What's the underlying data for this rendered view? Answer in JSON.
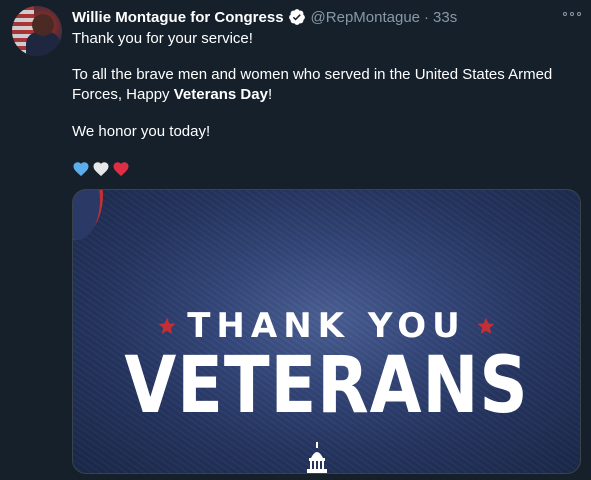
{
  "tweet": {
    "display_name": "Willie Montague for Congress",
    "handle": "@RepMontague",
    "separator": "·",
    "time": "33s",
    "text": {
      "line1": "Thank you for your service!",
      "line2": "To all the brave men and women who served in the United States Armed",
      "line3_prefix": "Forces, Happy ",
      "line3_bold": "Veterans Day",
      "line3_suffix": "!",
      "line4": "We honor you today!"
    },
    "hearts": [
      "blue-heart",
      "white-heart",
      "red-heart"
    ]
  },
  "media": {
    "thank_you": "THANK YOU",
    "veterans": "VETERANS"
  },
  "colors": {
    "background": "#15202b",
    "secondary_text": "#8899a6",
    "accent_blue": "#1da1f2",
    "star_red": "#c22f36",
    "border": "#38444d"
  },
  "icons": {
    "verified": "verified-badge-icon",
    "more": "more-options-icon",
    "star": "star-icon",
    "capitol": "capitol-dome-icon"
  }
}
